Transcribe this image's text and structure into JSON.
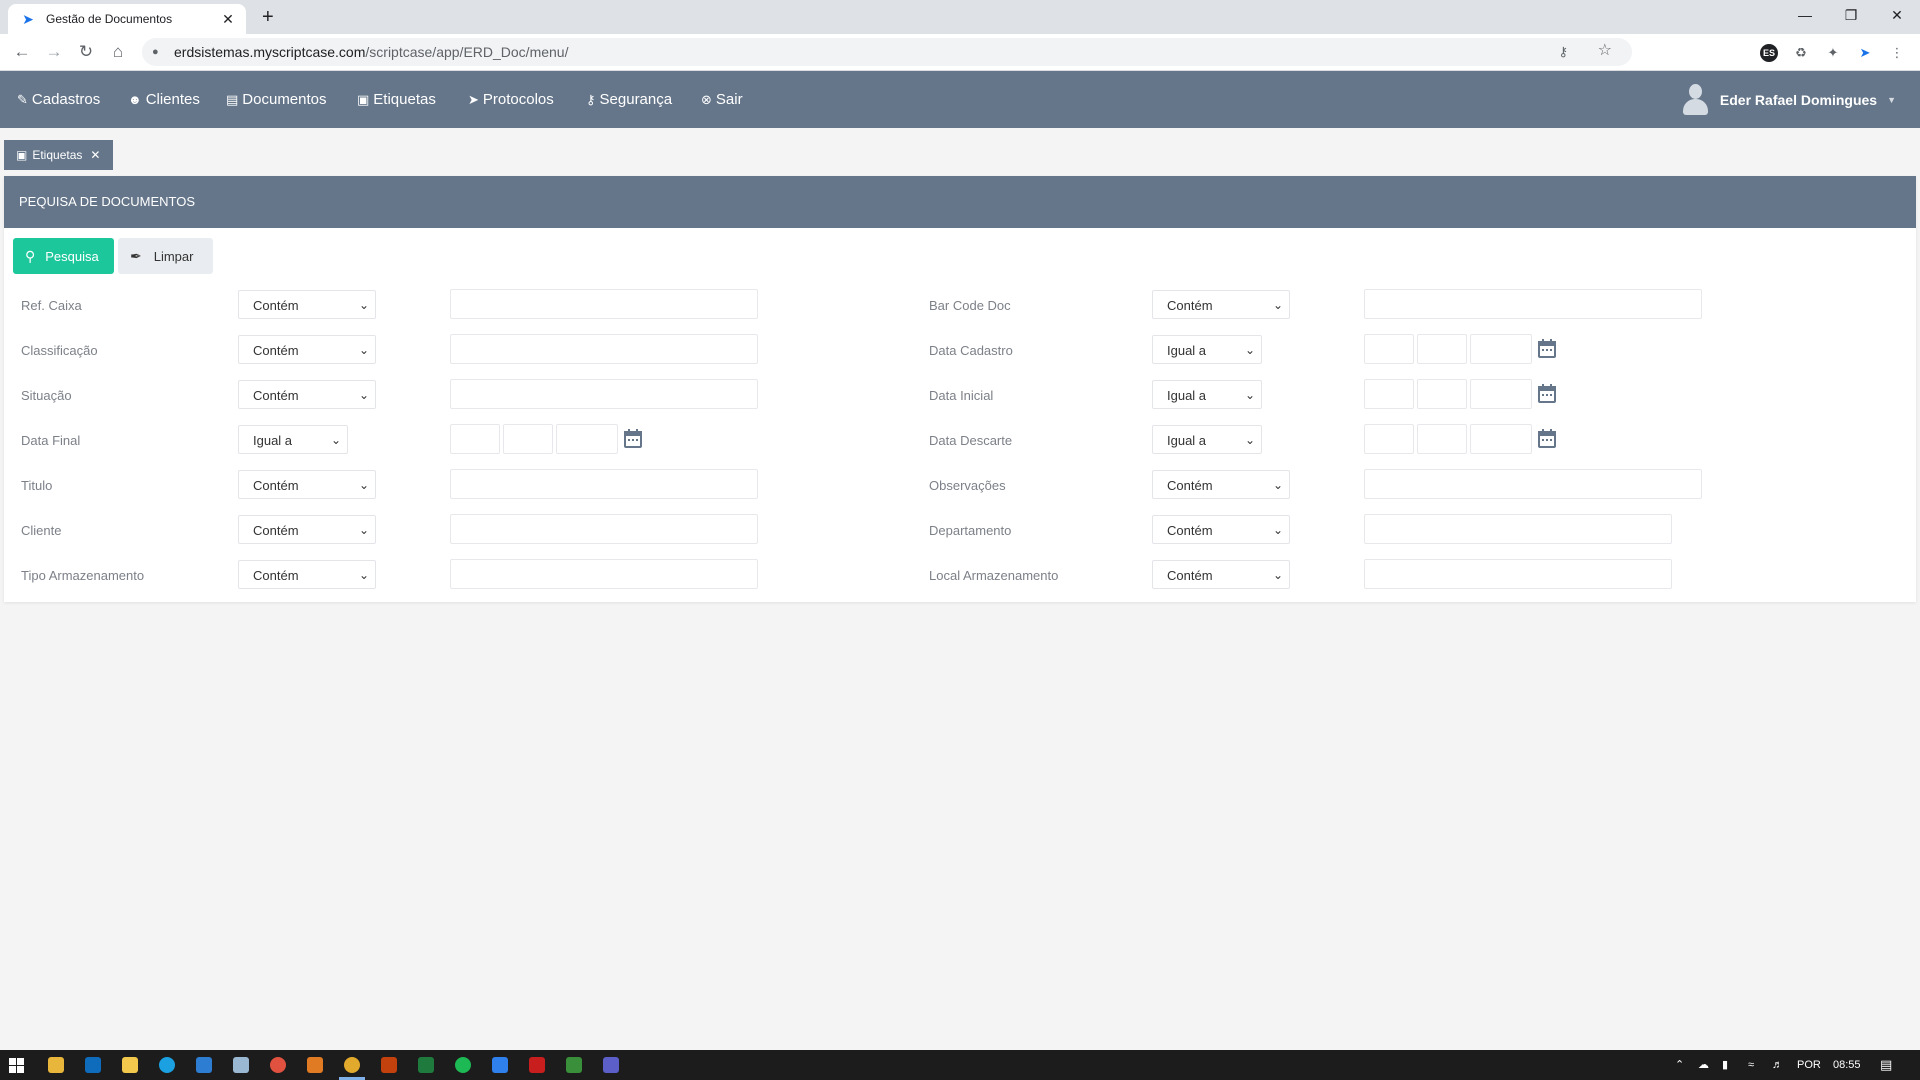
{
  "browser": {
    "tab_title": "Gestão de Documentos",
    "url_host": "erdsistemas.myscriptcase.com",
    "url_path": "/scriptcase/app/ERD_Doc/menu/",
    "extension_badge": "ES"
  },
  "menu": {
    "items": [
      {
        "label": "Cadastros",
        "icon": "edit-square-icon"
      },
      {
        "label": "Clientes",
        "icon": "user-icon"
      },
      {
        "label": "Documentos",
        "icon": "archive-box-icon"
      },
      {
        "label": "Etiquetas",
        "icon": "tags-icon"
      },
      {
        "label": "Protocolos",
        "icon": "paper-plane-icon"
      },
      {
        "label": "Segurança",
        "icon": "key-icon"
      },
      {
        "label": "Sair",
        "icon": "close-circle-icon"
      }
    ],
    "user_name": "Eder Rafael Domingues"
  },
  "app_tab": {
    "label": "Etiquetas"
  },
  "panel": {
    "title": "PEQUISA DE DOCUMENTOS"
  },
  "toolbar": {
    "search_label": "Pesquisa",
    "clear_label": "Limpar"
  },
  "fields": {
    "left": [
      {
        "label": "Ref. Caixa",
        "operator": "Contém"
      },
      {
        "label": "Classificação",
        "operator": "Contém"
      },
      {
        "label": "Situação",
        "operator": "Contém"
      },
      {
        "label": "Data Final",
        "operator": "Igual a"
      },
      {
        "label": "Titulo",
        "operator": "Contém"
      },
      {
        "label": "Cliente",
        "operator": "Contém"
      },
      {
        "label": "Tipo Armazenamento",
        "operator": "Contém"
      }
    ],
    "right": [
      {
        "label": "Bar Code Doc",
        "operator": "Contém"
      },
      {
        "label": "Data Cadastro",
        "operator": "Igual a"
      },
      {
        "label": "Data Inicial",
        "operator": "Igual a"
      },
      {
        "label": "Data Descarte",
        "operator": "Igual a"
      },
      {
        "label": "Observações",
        "operator": "Contém"
      },
      {
        "label": "Departamento",
        "operator": "Contém"
      },
      {
        "label": "Local Armazenamento",
        "operator": "Contém"
      }
    ]
  },
  "taskbar": {
    "language": "POR",
    "time": "08:55"
  },
  "colors": {
    "header": "#65768a",
    "search_button": "#1dc79c",
    "clear_button": "#e9ecf0"
  }
}
